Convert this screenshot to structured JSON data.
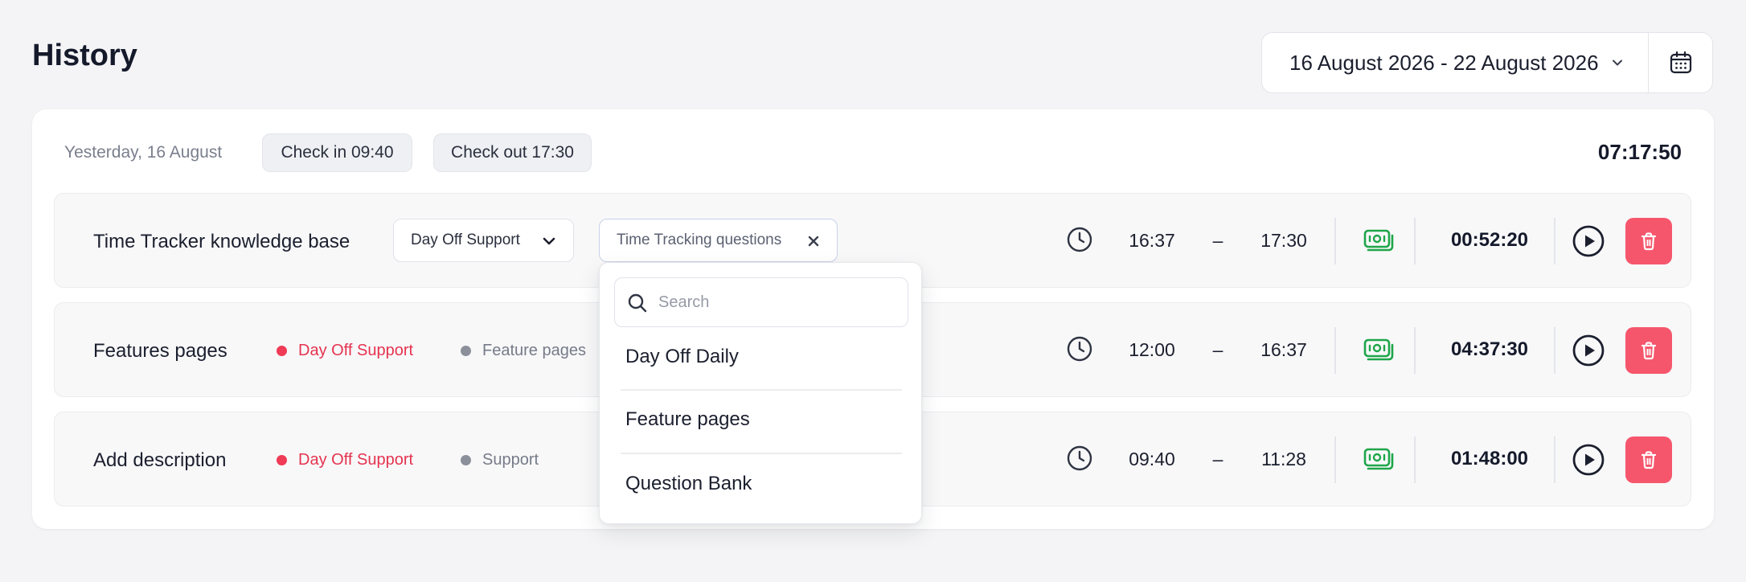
{
  "page": {
    "title": "History"
  },
  "date_range": {
    "label": "16 August 2026 - 22 August 2026",
    "icon": "calendar-icon"
  },
  "day": {
    "label": "Yesterday, 16 August",
    "check_in": "Check in 09:40",
    "check_out": "Check out 17:30",
    "total": "07:17:50"
  },
  "entries": [
    {
      "title": "Time Tracker knowledge base",
      "project": "Day Off Support",
      "task": "Time Tracking questions",
      "start": "16:37",
      "dash": "–",
      "end": "17:30",
      "duration": "00:52:20"
    },
    {
      "title": "Features pages",
      "project": "Day Off Support",
      "task": "Feature pages",
      "start": "12:00",
      "dash": "–",
      "end": "16:37",
      "duration": "04:37:30"
    },
    {
      "title": "Add description",
      "project": "Day Off Support",
      "task": "Support",
      "start": "09:40",
      "dash": "–",
      "end": "11:28",
      "duration": "01:48:00"
    }
  ],
  "task_dropdown": {
    "search_placeholder": "Search",
    "search_value": "",
    "options": [
      "Day Off Daily",
      "Feature pages",
      "Question Bank"
    ]
  },
  "colors": {
    "project_red": "#ef3b55",
    "delete_bg": "#f6566c",
    "billable_green": "#1fa54a",
    "text_dark": "#151a2b"
  }
}
